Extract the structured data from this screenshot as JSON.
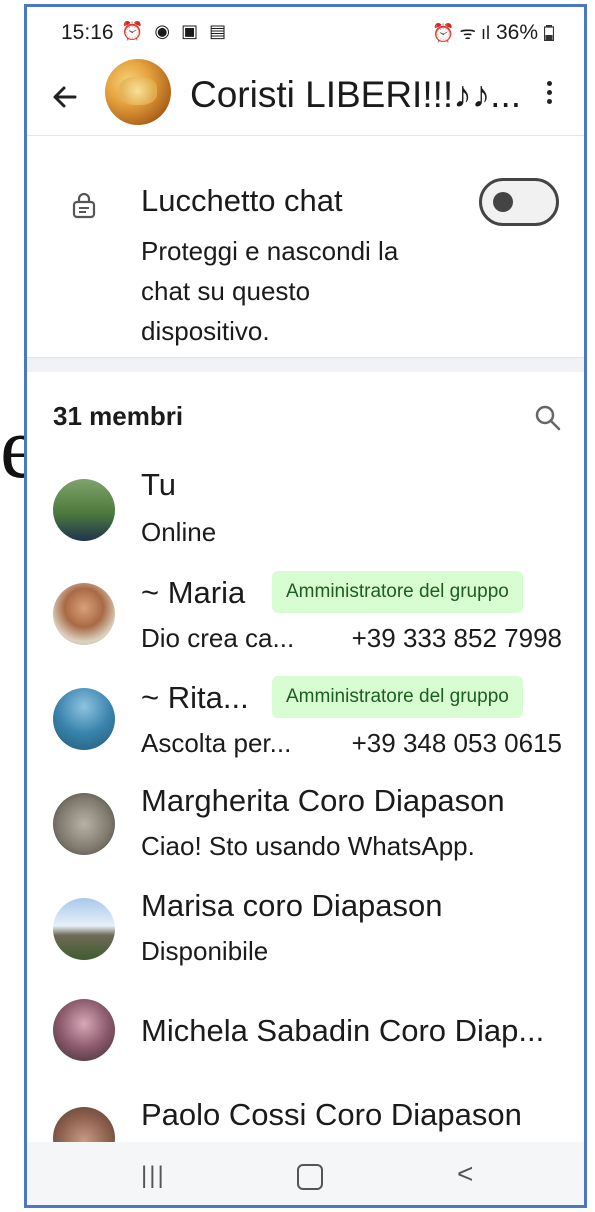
{
  "stray_glyph": "e",
  "status_bar": {
    "time": "15:16",
    "left_icons": "⏰ ◉ ▣ ▤",
    "right_icons": "⏰ ᯤ ıl",
    "battery": "36%"
  },
  "header": {
    "group_name": "Coristi LIBERI!!!♪♪..."
  },
  "chat_lock": {
    "title": "Lucchetto chat",
    "description": "Proteggi e nascondi la chat su questo dispositivo.",
    "enabled": false
  },
  "members": {
    "count_label": "31 membri",
    "list": [
      {
        "name": "Tu",
        "sub": "Online",
        "phone": "",
        "badge": ""
      },
      {
        "name": "~ Maria",
        "sub": "Dio crea ca...",
        "phone": "+39 333 852 7998",
        "badge": "Amministratore del gruppo"
      },
      {
        "name": "~ Rita...",
        "sub": "Ascolta per...",
        "phone": "+39 348 053 0615",
        "badge": "Amministratore del gruppo"
      },
      {
        "name": "Margherita Coro Diapason",
        "sub": "Ciao! Sto usando WhatsApp.",
        "phone": "",
        "badge": ""
      },
      {
        "name": "Marisa coro Diapason",
        "sub": "Disponibile",
        "phone": "",
        "badge": ""
      },
      {
        "name": "Michela Sabadin Coro Diap...",
        "sub": "",
        "phone": "",
        "badge": ""
      },
      {
        "name": "Paolo Cossi Coro Diapason",
        "sub": "",
        "phone": "",
        "badge": ""
      }
    ]
  },
  "nav_bar": {
    "recent": "|||",
    "back": "<"
  }
}
